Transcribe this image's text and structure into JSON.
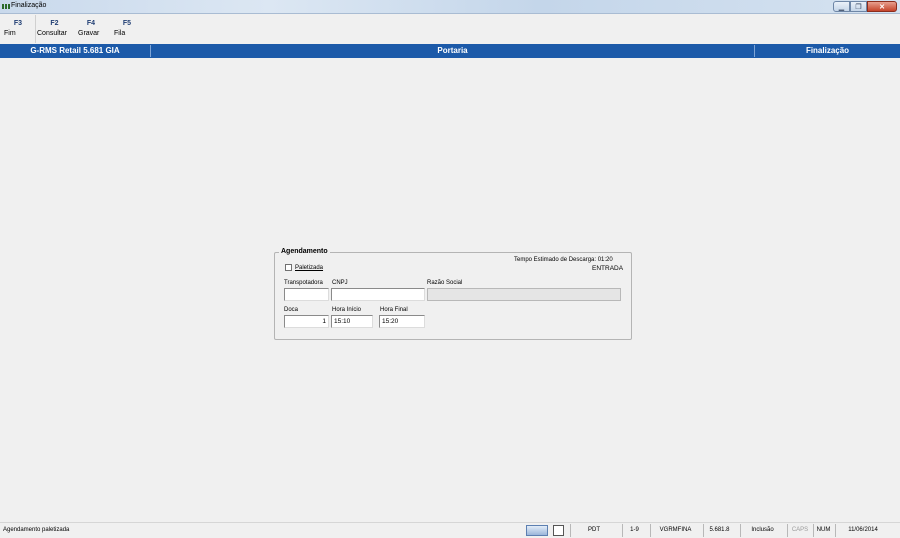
{
  "window": {
    "title": "Finalização"
  },
  "toolbar": {
    "buttons": [
      {
        "key": "F3",
        "label": "Fim"
      },
      {
        "key": "F2",
        "label": "Consultar"
      },
      {
        "key": "F4",
        "label": "Gravar"
      },
      {
        "key": "F5",
        "label": "Fila"
      }
    ]
  },
  "header": {
    "app_version": "G-RMS Retail 5.681 GIA",
    "module": "Portaria",
    "screen": "Finalização"
  },
  "form": {
    "group_title": "Agendamento",
    "tempo_estimado": "Tempo Estimado de Descarga: 01:20",
    "tipo": "ENTRADA",
    "paletizada_label": "Paletizada",
    "paletizada_checked": false,
    "transportadora_label": "Transpotadora",
    "transportadora_value": "",
    "cnpj_label": "CNPJ",
    "cnpj_value": "",
    "razao_social_label": "Razão Social",
    "razao_social_value": "",
    "doca_label": "Doca",
    "doca_value": "1",
    "hora_inicio_label": "Hora Início",
    "hora_inicio_value": "15:10",
    "hora_final_label": "Hora Final",
    "hora_final_value": "15:20"
  },
  "statusbar": {
    "message": "Agendamento paletizada",
    "pdt": "PDT",
    "range": "1-9",
    "program": "VGRMFINA",
    "version": "5.681.8",
    "mode": "Inclusão",
    "caps": "CAPS",
    "num": "NUM",
    "date": "11/06/2014"
  }
}
